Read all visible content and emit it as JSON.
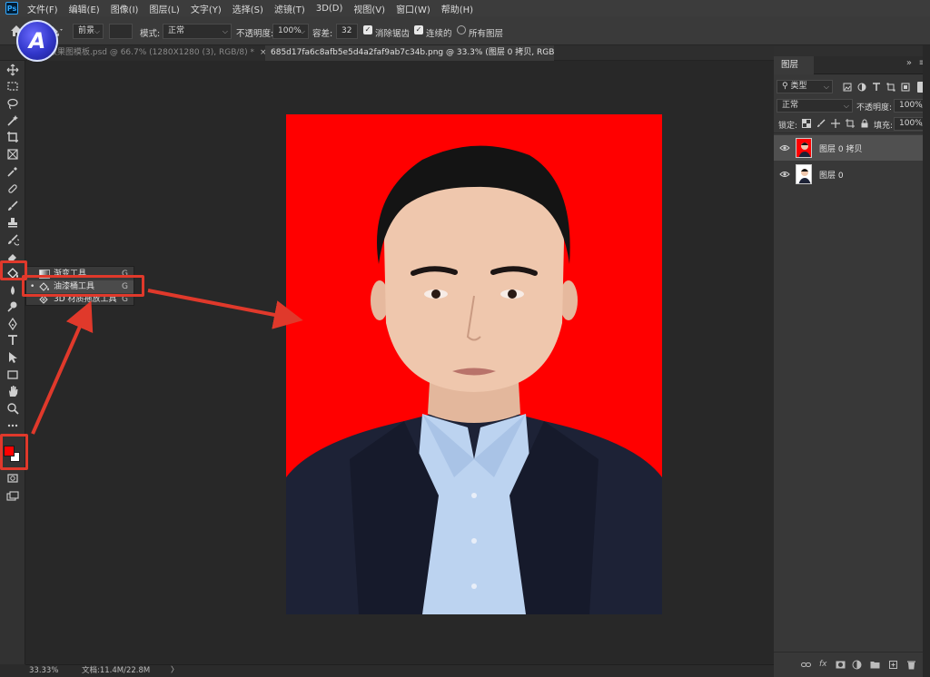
{
  "app": {
    "logo_text": "Ps",
    "badge_letter": "A",
    "menu": [
      "文件(F)",
      "编辑(E)",
      "图像(I)",
      "图层(L)",
      "文字(Y)",
      "选择(S)",
      "滤镜(T)",
      "3D(D)",
      "视图(V)",
      "窗口(W)",
      "帮助(H)"
    ]
  },
  "options": {
    "fill_source": "前景",
    "mode_label": "模式:",
    "mode_value": "正常",
    "opacity_label": "不透明度:",
    "opacity_value": "100%",
    "tolerance_label": "容差:",
    "tolerance_value": "32",
    "antialias_label": "消除锯齿",
    "antialias_checked": true,
    "contiguous_label": "连续的",
    "contiguous_checked": true,
    "all_layers_label": "所有图层",
    "all_layers_checked": false
  },
  "tabs": [
    {
      "label": "对比效果图模板.psd @ 66.7% (1280X1280 (3), RGB/8) *",
      "active": false
    },
    {
      "label": "685d17fa6c8afb5e5d4a2faf9ab7c34b.png @ 33.3% (图层 0 拷贝, RGB/8) *",
      "active": true
    }
  ],
  "tools": [
    "move-tool",
    "marquee-tool",
    "lasso-tool",
    "magic-wand-tool",
    "crop-tool",
    "frame-tool",
    "eyedropper-tool",
    "healing-brush-tool",
    "brush-tool",
    "stamp-tool",
    "history-brush-tool",
    "eraser-tool",
    "paint-bucket-tool",
    "blur-tool",
    "dodge-tool",
    "pen-tool",
    "type-tool",
    "path-selection-tool",
    "rectangle-tool",
    "hand-tool",
    "zoom-tool",
    "more-tools",
    "foreground-background-colors",
    "quick-mask",
    "screen-mode"
  ],
  "colors": {
    "foreground": "#ff0000",
    "background": "#ffffff",
    "document_background": "#ff0000",
    "annotation": "#e0392b"
  },
  "flyout": {
    "items": [
      {
        "label": "渐变工具",
        "key": "G",
        "active": false
      },
      {
        "label": "油漆桶工具",
        "key": "G",
        "active": true
      },
      {
        "label": "3D 材质拖放工具",
        "key": "G",
        "active": false
      }
    ]
  },
  "layers_panel": {
    "tab_label": "图层",
    "collapse_glyph": "»",
    "menu_glyph": "≡",
    "filter_kind": "类型",
    "blend_mode": "正常",
    "opacity_label": "不透明度:",
    "opacity_value": "100%",
    "lock_label": "锁定:",
    "fill_label": "填充:",
    "fill_value": "100%",
    "layers": [
      {
        "name": "图层 0 拷贝",
        "selected": true,
        "visible": true,
        "background": "#ff0000"
      },
      {
        "name": "图层 0",
        "selected": false,
        "visible": true,
        "background": "#ffffff"
      }
    ]
  },
  "status": {
    "zoom": "33.33%",
    "doc_info": "文档:11.4M/22.8M",
    "caret": "〉"
  }
}
